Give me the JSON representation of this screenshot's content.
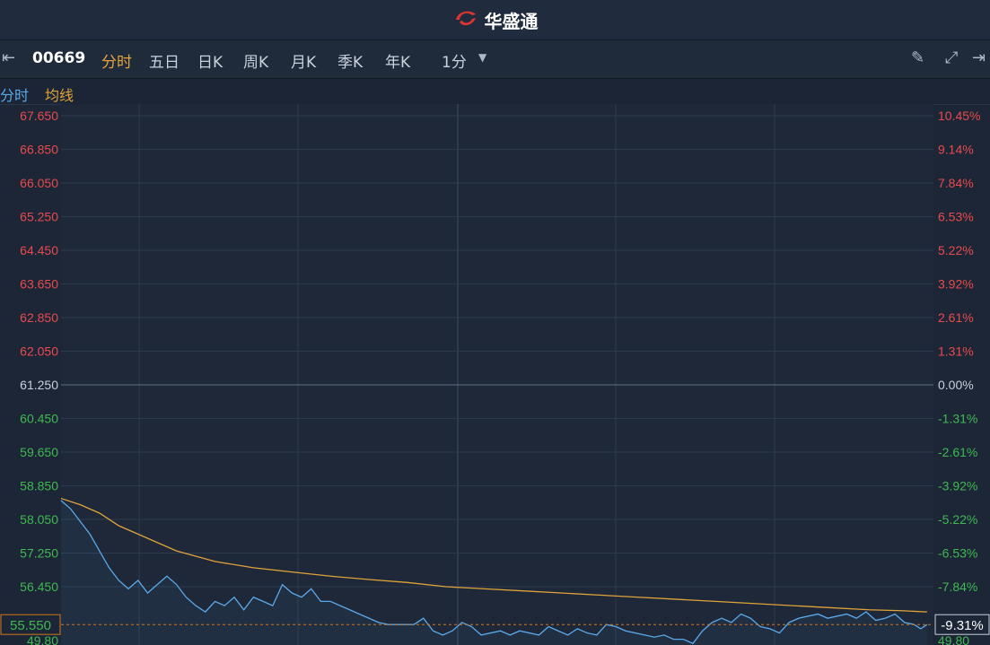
{
  "app": {
    "brand": "华盛通"
  },
  "toolbar": {
    "stock_code": "00669",
    "tabs": [
      "分时",
      "五日",
      "日K",
      "周K",
      "月K",
      "季K",
      "年K"
    ],
    "active_tab": "分时",
    "interval": "1分"
  },
  "legend": {
    "price_label": "分时",
    "avg_label": "均线"
  },
  "colors": {
    "price_line": "#5aa9ea",
    "avg_line": "#e0a33a",
    "up": "#e84b4b",
    "down": "#3fb950",
    "neutral": "#c8d0dc",
    "active": "#e6a33c"
  },
  "chart_data": {
    "type": "line",
    "prev_close": 61.25,
    "left_axis_labels": [
      "67.650",
      "66.850",
      "66.050",
      "65.250",
      "64.450",
      "63.650",
      "62.850",
      "62.050",
      "61.250",
      "60.450",
      "59.650",
      "58.850",
      "58.050",
      "57.250",
      "56.450",
      "49.80"
    ],
    "right_axis_labels": [
      "10.45%",
      "9.14%",
      "7.84%",
      "6.53%",
      "5.22%",
      "3.92%",
      "2.61%",
      "1.31%",
      "0.00%",
      "-1.31%",
      "-2.61%",
      "-3.92%",
      "-5.22%",
      "-6.53%",
      "-7.84%",
      "49.80"
    ],
    "current_price_label": "55.550",
    "current_change_label": "-9.31%",
    "ylim": [
      49.8,
      67.65
    ],
    "xlim": [
      0,
      272
    ],
    "series": [
      {
        "name": "分时",
        "x": [
          0,
          3,
          6,
          9,
          12,
          15,
          18,
          21,
          24,
          27,
          30,
          33,
          36,
          39,
          42,
          45,
          48,
          51,
          54,
          57,
          60,
          63,
          66,
          69,
          72,
          75,
          78,
          81,
          84,
          87,
          90,
          93,
          96,
          99,
          102,
          105,
          108,
          110,
          113,
          116,
          119,
          122,
          125,
          128,
          131,
          134,
          137,
          140,
          143,
          146,
          149,
          152,
          155,
          158,
          161,
          164,
          167,
          170,
          173,
          176,
          179,
          182,
          185,
          188,
          191,
          194,
          197,
          200,
          203,
          206,
          209,
          212,
          215,
          218,
          221,
          224,
          227,
          230,
          233,
          236,
          239,
          242,
          245,
          248,
          251,
          254,
          257,
          260,
          263,
          266,
          268,
          270
        ],
        "values": [
          58.5,
          58.3,
          58.0,
          57.7,
          57.3,
          56.9,
          56.6,
          56.4,
          56.6,
          56.3,
          56.5,
          56.7,
          56.5,
          56.2,
          56.0,
          55.85,
          56.1,
          56.0,
          56.2,
          55.9,
          56.2,
          56.1,
          56.0,
          56.5,
          56.3,
          56.2,
          56.4,
          56.1,
          56.1,
          56.0,
          55.9,
          55.8,
          55.7,
          55.6,
          55.55,
          55.55,
          55.55,
          55.55,
          55.7,
          55.4,
          55.3,
          55.4,
          55.6,
          55.5,
          55.3,
          55.35,
          55.4,
          55.3,
          55.4,
          55.35,
          55.3,
          55.5,
          55.4,
          55.3,
          55.45,
          55.35,
          55.3,
          55.55,
          55.5,
          55.4,
          55.35,
          55.3,
          55.25,
          55.3,
          55.2,
          55.2,
          55.1,
          55.4,
          55.6,
          55.7,
          55.6,
          55.8,
          55.7,
          55.5,
          55.45,
          55.35,
          55.6,
          55.7,
          55.75,
          55.8,
          55.7,
          55.75,
          55.8,
          55.7,
          55.85,
          55.65,
          55.7,
          55.8,
          55.6,
          55.55,
          55.45,
          55.55
        ]
      },
      {
        "name": "均线",
        "x": [
          0,
          6,
          12,
          18,
          24,
          30,
          36,
          48,
          60,
          72,
          84,
          96,
          108,
          120,
          132,
          144,
          156,
          168,
          180,
          192,
          204,
          216,
          228,
          240,
          252,
          262,
          270
        ],
        "values": [
          58.55,
          58.4,
          58.2,
          57.9,
          57.7,
          57.5,
          57.3,
          57.05,
          56.9,
          56.8,
          56.7,
          56.62,
          56.55,
          56.45,
          56.4,
          56.35,
          56.3,
          56.25,
          56.2,
          56.15,
          56.1,
          56.05,
          56.0,
          55.95,
          55.9,
          55.88,
          55.85
        ]
      }
    ]
  }
}
